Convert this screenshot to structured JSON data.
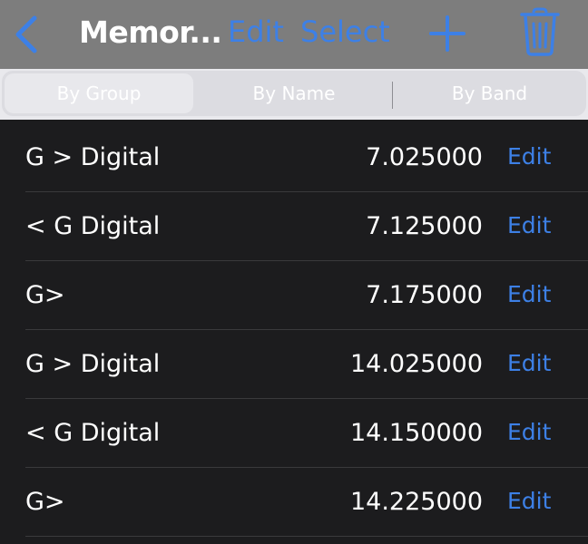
{
  "nav": {
    "title": "Memor...",
    "edit_label": "Edit",
    "select_label": "Select",
    "back_icon": "chevron-left-icon",
    "add_icon": "plus-icon",
    "delete_icon": "trash-icon"
  },
  "segments": [
    {
      "label": "By Group",
      "selected": true
    },
    {
      "label": "By Name",
      "selected": false
    },
    {
      "label": "By Band",
      "selected": false
    }
  ],
  "memories": [
    {
      "name": "G > Digital",
      "frequency": "7.025000",
      "action": "Edit"
    },
    {
      "name": "< G Digital",
      "frequency": "7.125000",
      "action": "Edit"
    },
    {
      "name": "G>",
      "frequency": "7.175000",
      "action": "Edit"
    },
    {
      "name": "G > Digital",
      "frequency": "14.025000",
      "action": "Edit"
    },
    {
      "name": "< G Digital",
      "frequency": "14.150000",
      "action": "Edit"
    },
    {
      "name": "G>",
      "frequency": "14.225000",
      "action": "Edit"
    }
  ],
  "colors": {
    "accent": "#3d80e6",
    "nav_background": "#7d7d7d",
    "list_background": "#1c1c1e"
  }
}
